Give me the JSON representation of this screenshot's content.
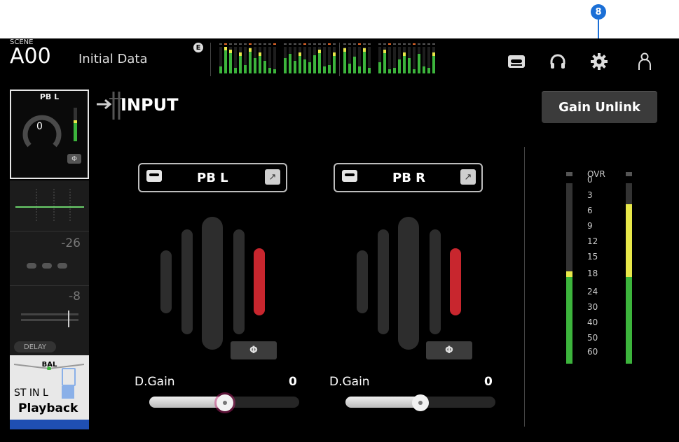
{
  "callout": {
    "number": "8"
  },
  "header": {
    "scene_label": "SCENE",
    "scene_number": "A00",
    "scene_name": "Initial Data",
    "e_badge": "E",
    "icons": [
      "recorder-icon",
      "headphones-icon",
      "gear-icon",
      "user-icon"
    ]
  },
  "strip": {
    "name": "PB L",
    "knob_value": "0",
    "phase": "Φ",
    "threshold_value": "-26",
    "comp_value": "-8",
    "delay_label": "DELAY",
    "bal_label": "BAL",
    "channel_id": "ST IN L",
    "channel_label": "Playback"
  },
  "input": {
    "title": "INPUT",
    "gain_unlink_label": "Gain Unlink"
  },
  "channels": [
    {
      "name": "PB L",
      "phase": "Φ",
      "dgain_label": "D.Gain",
      "dgain_value": "0",
      "slider_position": 0.5,
      "selected": true
    },
    {
      "name": "PB R",
      "phase": "Φ",
      "dgain_label": "D.Gain",
      "dgain_value": "0",
      "slider_position": 0.5,
      "selected": false
    }
  ],
  "meter": {
    "scale": [
      "OVR",
      "0",
      "3",
      "6",
      "9",
      "12",
      "15",
      "18",
      "24",
      "30",
      "40",
      "50",
      "60"
    ],
    "colors": {
      "green": "#3cb43c",
      "yellow": "#e8e84a",
      "red": "#e03a3a",
      "orange": "#e86a2a"
    }
  }
}
